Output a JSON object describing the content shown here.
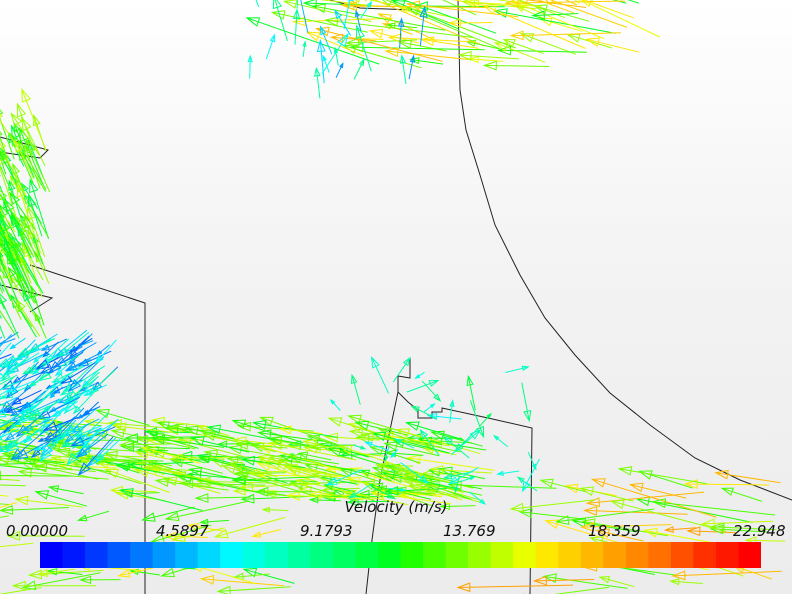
{
  "legend": {
    "title": "Velocity (m/s)",
    "ticks": [
      "0.00000",
      "4.5897",
      "9.1793",
      "13.769",
      "18.359",
      "22.948"
    ],
    "min": 0.0,
    "max": 22.948,
    "colors": [
      "#0000ff",
      "#0018ff",
      "#0038ff",
      "#0058ff",
      "#0078ff",
      "#0098ff",
      "#00b8ff",
      "#00d8ff",
      "#00f8ff",
      "#00ffe0",
      "#00ffc0",
      "#00ffa0",
      "#00ff80",
      "#00ff60",
      "#00ff40",
      "#00ff20",
      "#20ff00",
      "#48ff00",
      "#70ff00",
      "#98ff00",
      "#c0ff00",
      "#e8ff00",
      "#ffe800",
      "#ffd000",
      "#ffb800",
      "#ffa000",
      "#ff8800",
      "#ff7000",
      "#ff5000",
      "#ff3000",
      "#ff1800",
      "#ff0000"
    ]
  }
}
